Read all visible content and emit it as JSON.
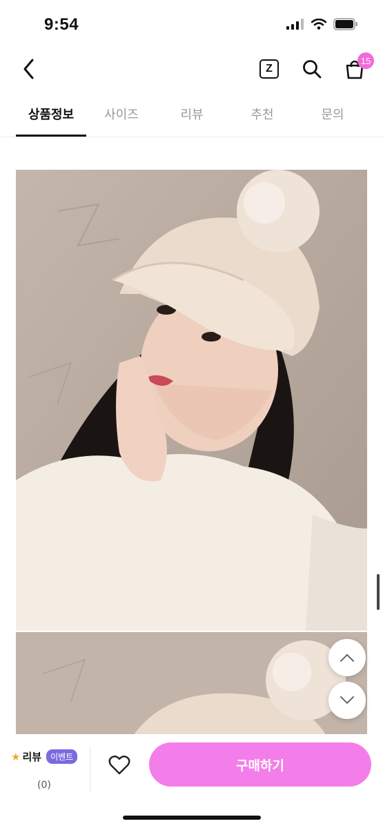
{
  "status_bar": {
    "time": "9:54"
  },
  "header": {
    "back_icon": "chevron-left-icon",
    "z_label": "Z",
    "cart_badge": "15"
  },
  "tabs": [
    {
      "label": "상품정보",
      "active": true
    },
    {
      "label": "사이즈",
      "active": false
    },
    {
      "label": "리뷰",
      "active": false
    },
    {
      "label": "추천",
      "active": false
    },
    {
      "label": "문의",
      "active": false
    }
  ],
  "bottom_bar": {
    "review_label": "리뷰",
    "event_badge": "이벤트",
    "review_count": "(0)",
    "buy_label": "구매하기"
  },
  "colors": {
    "accent": "#f47ee9",
    "badge": "#f26ad8",
    "event": "#7a6ae0",
    "star": "#f5a623"
  }
}
